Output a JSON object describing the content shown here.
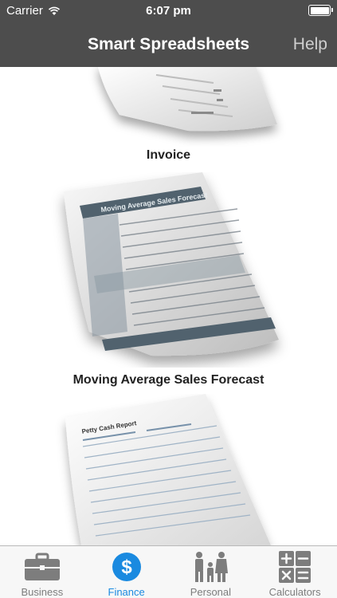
{
  "status_bar": {
    "carrier": "Carrier",
    "time": "6:07 pm"
  },
  "nav_bar": {
    "title": "Smart Spreadsheets",
    "help": "Help"
  },
  "items": [
    {
      "label": "Invoice"
    },
    {
      "label": "Moving Average Sales Forecast",
      "sheet_title": "Moving Average Sales Forecast"
    },
    {
      "label": "",
      "sheet_title": "Petty Cash Report"
    }
  ],
  "tabs": [
    {
      "label": "Business",
      "icon": "briefcase-icon",
      "active": false
    },
    {
      "label": "Finance",
      "icon": "dollar-icon",
      "active": true
    },
    {
      "label": "Personal",
      "icon": "family-icon",
      "active": false
    },
    {
      "label": "Calculators",
      "icon": "calculator-icon",
      "active": false
    }
  ],
  "colors": {
    "bar": "#4d4d4d",
    "accent": "#1a8ae0",
    "tab_inactive": "#7d7d7d"
  }
}
